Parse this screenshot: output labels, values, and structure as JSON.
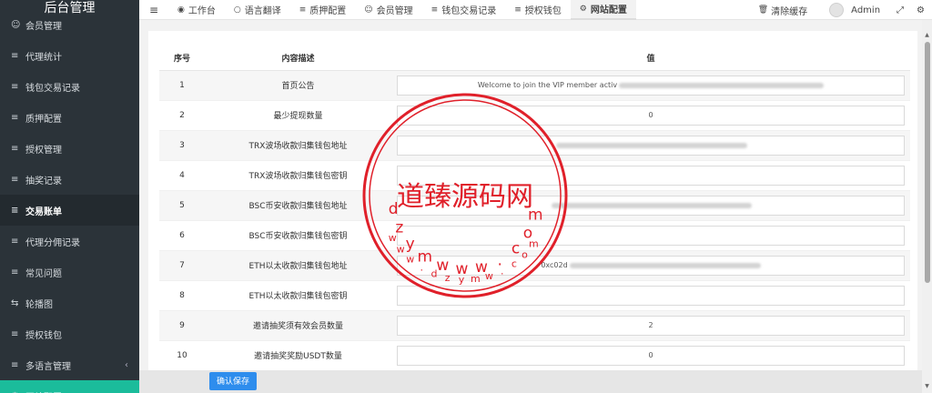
{
  "brand": "后台管理",
  "sidebar": {
    "items": [
      {
        "icon": "user-icon",
        "glyph": "☺",
        "label": "会员管理"
      },
      {
        "icon": "list-icon",
        "glyph": "≡",
        "label": "代理统计"
      },
      {
        "icon": "list-icon",
        "glyph": "≡",
        "label": "钱包交易记录"
      },
      {
        "icon": "list-icon",
        "glyph": "≡",
        "label": "质押配置"
      },
      {
        "icon": "list-icon",
        "glyph": "≡",
        "label": "授权管理"
      },
      {
        "icon": "list-icon",
        "glyph": "≡",
        "label": "抽奖记录"
      },
      {
        "icon": "list-icon",
        "glyph": "≡",
        "label": "交易账单"
      },
      {
        "icon": "list-icon",
        "glyph": "≡",
        "label": "代理分佣记录"
      },
      {
        "icon": "list-icon",
        "glyph": "≡",
        "label": "常见问题"
      },
      {
        "icon": "refresh-icon",
        "glyph": "⇆",
        "label": "轮播图"
      },
      {
        "icon": "list-icon",
        "glyph": "≡",
        "label": "授权钱包"
      },
      {
        "icon": "list-icon",
        "glyph": "≡",
        "label": "多语言管理"
      },
      {
        "icon": "gear-icon",
        "glyph": "⚙",
        "label": "网站配置"
      }
    ]
  },
  "topbar": {
    "tabs": [
      {
        "icon": "dashboard-icon",
        "glyph": "◉",
        "label": "工作台"
      },
      {
        "icon": "circle-icon",
        "glyph": "○",
        "label": "语言翻译"
      },
      {
        "icon": "list-icon",
        "glyph": "≡",
        "label": "质押配置"
      },
      {
        "icon": "user-icon",
        "glyph": "☺",
        "label": "会员管理"
      },
      {
        "icon": "list-icon",
        "glyph": "≡",
        "label": "钱包交易记录"
      },
      {
        "icon": "list-icon",
        "glyph": "≡",
        "label": "授权钱包"
      },
      {
        "icon": "gear-icon",
        "glyph": "⚙",
        "label": "网站配置"
      }
    ],
    "clear_cache": "清除缓存",
    "user": "Admin"
  },
  "table": {
    "headers": [
      "序号",
      "内容描述",
      "值"
    ],
    "rows": [
      {
        "no": "1",
        "desc": "首页公告",
        "value": "Welcome to join the VIP member activ"
      },
      {
        "no": "2",
        "desc": "最少提现数量",
        "value": "0"
      },
      {
        "no": "3",
        "desc": "TRX波场收款归集钱包地址",
        "value": ""
      },
      {
        "no": "4",
        "desc": "TRX波场收款归集钱包密钥",
        "value": ""
      },
      {
        "no": "5",
        "desc": "BSC币安收款归集钱包地址",
        "value": ""
      },
      {
        "no": "6",
        "desc": "BSC币安收款归集钱包密钥",
        "value": ""
      },
      {
        "no": "7",
        "desc": "ETH以太收款归集钱包地址",
        "value": "0xc02d"
      },
      {
        "no": "8",
        "desc": "ETH以太收款归集钱包密钥",
        "value": ""
      },
      {
        "no": "9",
        "desc": "邀请抽奖须有效会员数量",
        "value": "2"
      },
      {
        "no": "10",
        "desc": "邀请抽奖奖励USDT数量",
        "value": "0"
      }
    ]
  },
  "save_button": "确认保存",
  "watermark": {
    "center": "道臻源码网",
    "ring_top": [
      "d",
      "z",
      "y",
      "m",
      "w",
      "w",
      "w",
      ".",
      "c",
      "o",
      "m"
    ],
    "ring_bottom": [
      "w",
      "w",
      "w",
      ".",
      "d",
      "z",
      "y",
      "m",
      "w",
      ".",
      "c",
      "o",
      "m"
    ],
    "color": "#e0202a"
  }
}
